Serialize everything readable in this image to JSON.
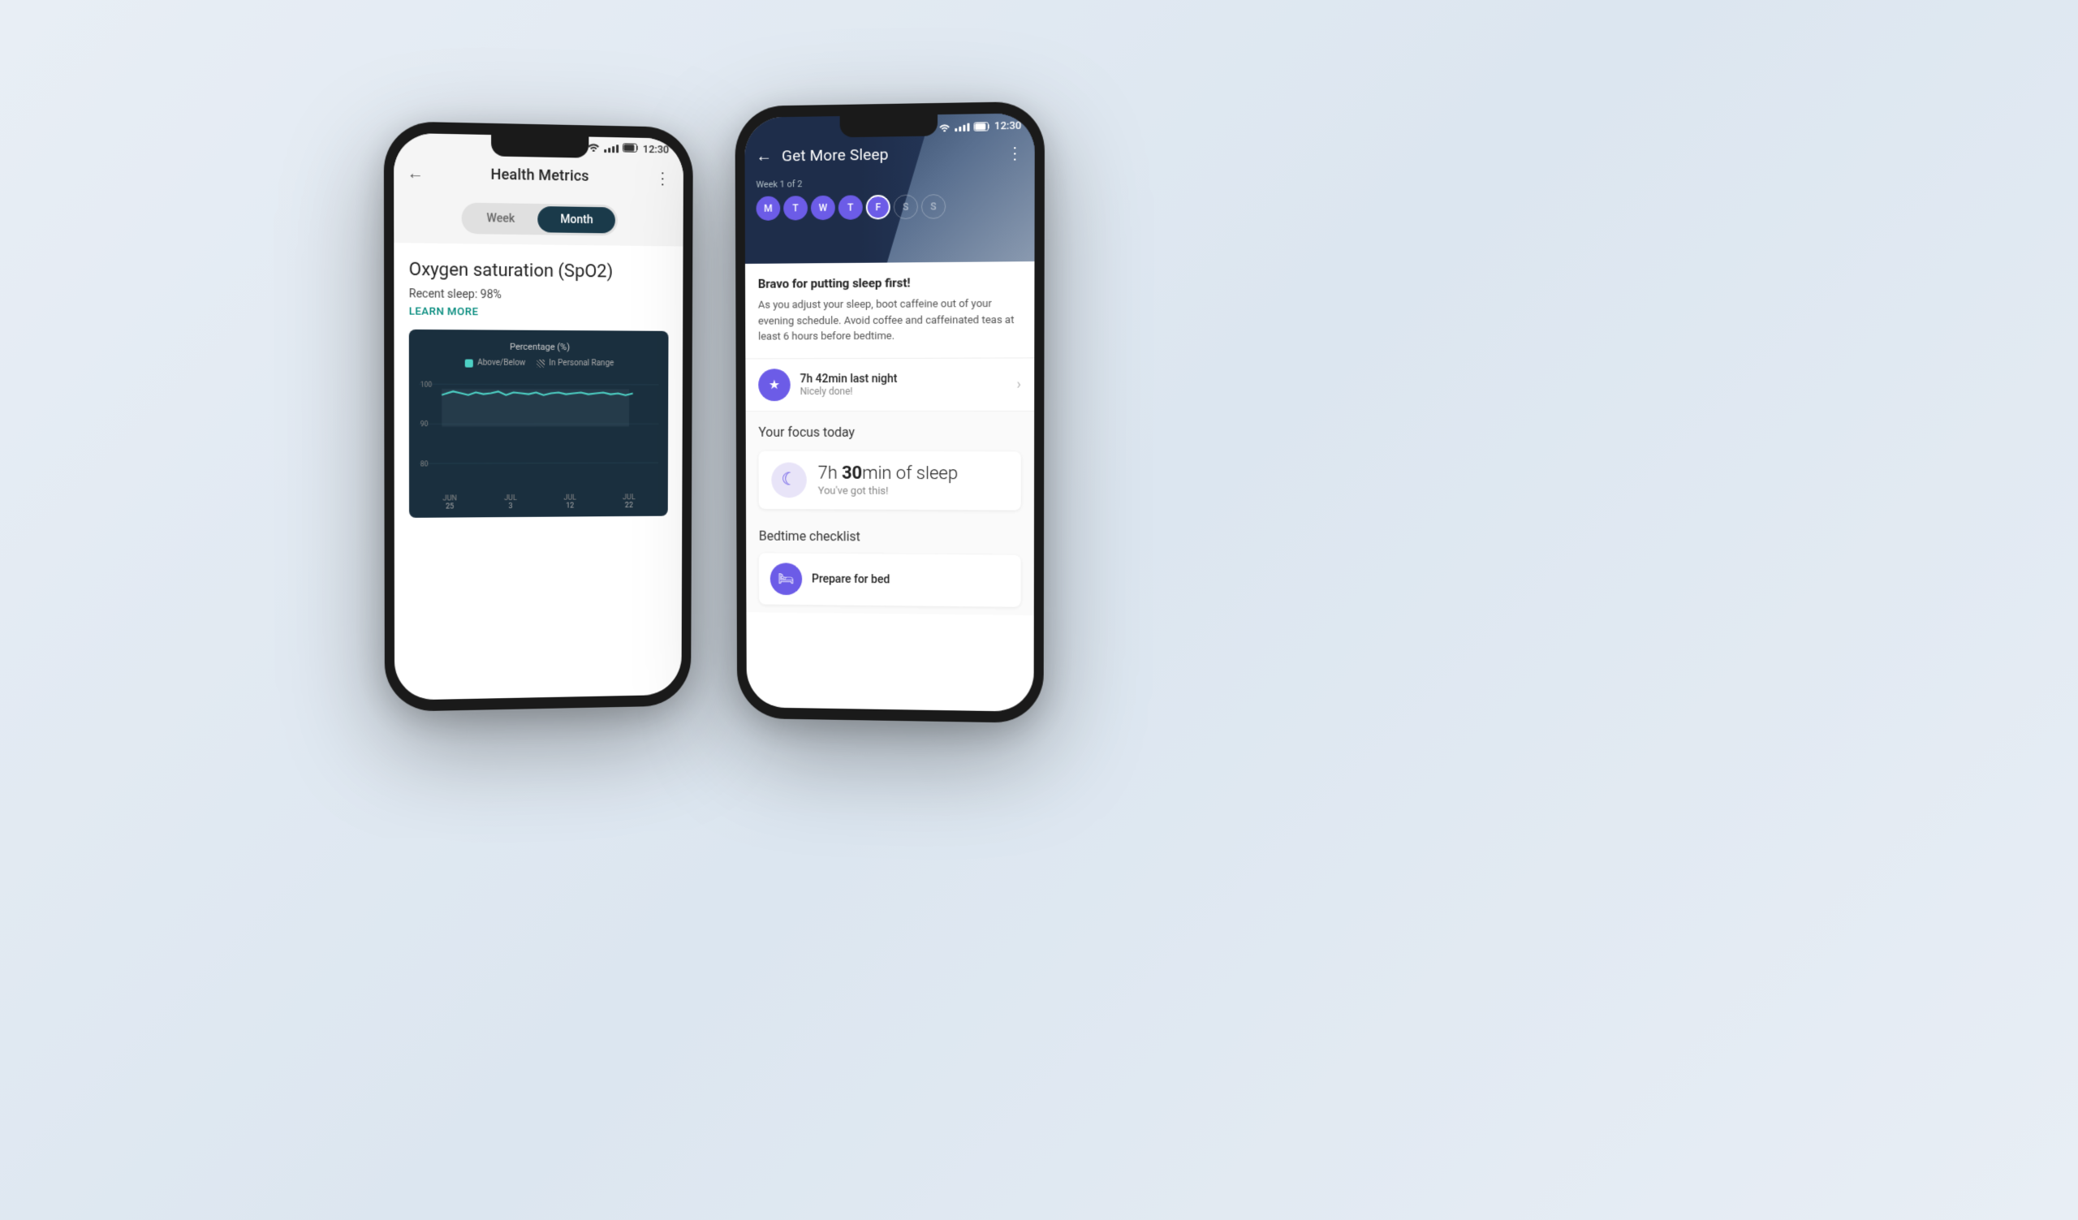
{
  "background": {
    "color": "#e8eef5"
  },
  "phone_left": {
    "status_bar": {
      "time": "12:30",
      "wifi_label": "wifi",
      "signal_label": "signal",
      "battery_label": "battery"
    },
    "toolbar": {
      "back_icon": "←",
      "title": "Health Metrics",
      "more_icon": "⋮"
    },
    "tabs": {
      "week_label": "Week",
      "month_label": "Month"
    },
    "metric": {
      "title": "Oxygen saturation (SpO2)",
      "subtitle": "Recent sleep: 98%",
      "learn_more": "LEARN MORE"
    },
    "chart": {
      "title": "Percentage (%)",
      "legend": [
        {
          "label": "Above/Below",
          "color": "teal"
        },
        {
          "label": "In Personal Range",
          "color": "gray"
        }
      ],
      "y_labels": [
        "100",
        "90",
        "80"
      ],
      "x_labels": [
        {
          "month": "JUN",
          "day": "25"
        },
        {
          "month": "JUL",
          "day": "3"
        },
        {
          "month": "JUL",
          "day": "12"
        },
        {
          "month": "JUL",
          "day": "22"
        }
      ]
    }
  },
  "phone_right": {
    "status_bar": {
      "time": "12:30"
    },
    "toolbar": {
      "back_icon": "←",
      "title": "Get More Sleep",
      "more_icon": "⋮"
    },
    "week_info": {
      "label": "Week 1 of 2",
      "days": [
        {
          "letter": "M",
          "state": "filled"
        },
        {
          "letter": "T",
          "state": "filled"
        },
        {
          "letter": "W",
          "state": "filled"
        },
        {
          "letter": "T",
          "state": "filled"
        },
        {
          "letter": "F",
          "state": "active"
        },
        {
          "letter": "S",
          "state": "empty"
        },
        {
          "letter": "S",
          "state": "empty"
        }
      ]
    },
    "bravo": {
      "title": "Bravo for putting sleep first!",
      "text": "As you adjust your sleep, boot caffeine out of your evening schedule. Avoid coffee and caffeinated teas at least 6 hours before bedtime."
    },
    "last_night": {
      "title": "7h 42min last night",
      "subtitle": "Nicely done!",
      "icon": "★"
    },
    "focus": {
      "section_title": "Your focus today",
      "hours": "7h",
      "minutes": "30",
      "unit": "min of sleep",
      "subtitle": "You've got this!",
      "icon": "☾"
    },
    "bedtime": {
      "section_title": "Bedtime checklist",
      "prepare_title": "Prepare for bed",
      "icon": "🛏"
    }
  }
}
